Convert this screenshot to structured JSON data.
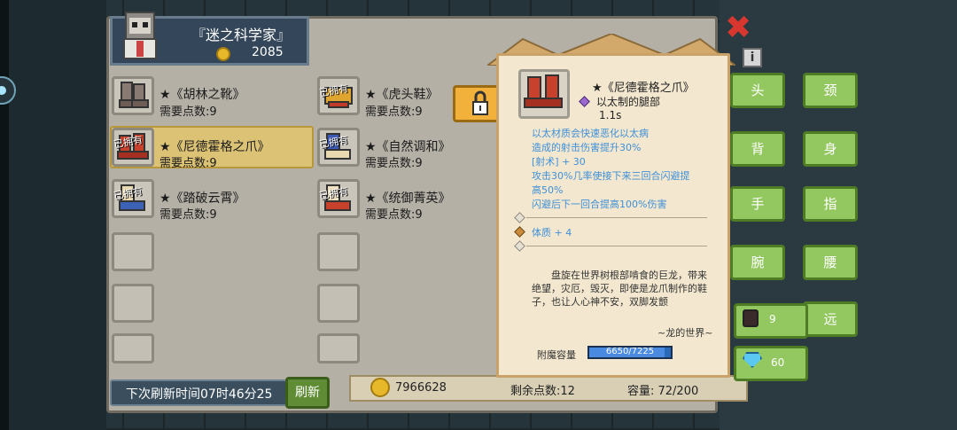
{
  "header": {
    "title": "『迷之科学家』",
    "gold": "2085"
  },
  "items": [
    {
      "name": "★《胡林之靴》",
      "points": "需要点数:9",
      "owned": ""
    },
    {
      "name": "★《虎头鞋》",
      "points": "需要点数:9",
      "owned": "已拥有"
    },
    {
      "name": "★《尼德霍格之爪》",
      "points": "需要点数:9",
      "owned": "已拥有"
    },
    {
      "name": "★《自然调和》",
      "points": "需要点数:9",
      "owned": "已拥有"
    },
    {
      "name": "★《踏破云霄》",
      "points": "需要点数:9",
      "owned": "已拥有"
    },
    {
      "name": "★《统御菁英》",
      "points": "需要点数:9",
      "owned": "已拥有"
    }
  ],
  "footer": {
    "refresh_time": "下次刷新时间07时46分25",
    "refresh_button": "刷新",
    "gold_total": "7966628",
    "remaining_points": "剩余点数:12",
    "capacity": "容量:  72/200"
  },
  "tooltip": {
    "name": "★《尼德霍格之爪》",
    "type": "以太制的腿部",
    "time": "1.1s",
    "effects": [
      "以太材质会快速恶化以太病",
      "造成的射击伤害提升30%",
      "[射术] + 30",
      "攻击30%几率使接下来三回合闪避提",
      "高50%",
      "闪避后下一回合提高100%伤害"
    ],
    "stat": "体质 + 4",
    "description": "盘旋在世界树根部啃食的巨龙，带来绝望，灾厄，毁灭，即使是龙爪制作的鞋子，也让人心神不安，双脚发颤",
    "signature": "~龙的世界~",
    "enchant_label": "附魔容量",
    "enchant_value": "6650/7225",
    "enchant_fraction": 0.92
  },
  "equipment": {
    "head": "头",
    "neck": "颈",
    "back": "背",
    "body": "身",
    "hand": "手",
    "finger": "指",
    "wrist": "腕",
    "waist": "腰",
    "ranged": "远"
  },
  "stats": {
    "followers": "9",
    "gems": "60"
  },
  "colors": {
    "accent": "#93c860",
    "effect_text": "#3f8fd8",
    "selected": "#dcc275"
  }
}
